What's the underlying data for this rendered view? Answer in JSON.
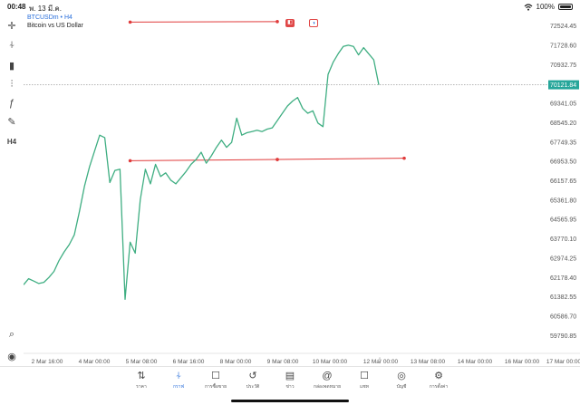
{
  "status_bar": {
    "time": "00:48",
    "date": "พ. 13 มี.ค.",
    "battery": "100%"
  },
  "chart": {
    "symbol": "BTCUSDm • H4",
    "description": "Bitcoin vs US Dollar",
    "current_price": "70121.84",
    "colors": {
      "line": "#3fae82",
      "trendline": "#e03b3b",
      "price_tag": "#26a69a",
      "accent": "#2a6fdb"
    }
  },
  "left_toolbar": [
    {
      "name": "crosshair-icon",
      "glyph": "✛"
    },
    {
      "name": "candles-icon",
      "glyph": "⍭"
    },
    {
      "name": "indicators-icon",
      "glyph": "▮"
    },
    {
      "name": "settings-sliders-icon",
      "glyph": "⫶"
    },
    {
      "name": "function-icon",
      "glyph": "ƒ"
    },
    {
      "name": "objects-icon",
      "glyph": "✎"
    },
    {
      "name": "timeframe-label",
      "glyph": "H4"
    },
    {
      "name": "search-chart-icon",
      "glyph": "⌕"
    },
    {
      "name": "app-logo-icon",
      "glyph": "◉"
    }
  ],
  "chart_data": {
    "type": "line",
    "x_ticks": [
      "2 Mar 16:00",
      "4 Mar 00:00",
      "5 Mar 08:00",
      "6 Mar 16:00",
      "8 Mar 00:00",
      "9 Mar 08:00",
      "10 Mar 00:00",
      "12 Mar 00:00",
      "13 Mar 08:00",
      "14 Mar 00:00",
      "16 Mar 00:00",
      "17 Mar 00:00"
    ],
    "y_ticks": [
      "72524.45",
      "71728.60",
      "70932.75",
      "70121.84",
      "69341.05",
      "68545.20",
      "67749.35",
      "66953.50",
      "66157.65",
      "65361.80",
      "64565.95",
      "63770.10",
      "62974.25",
      "62178.40",
      "61382.55",
      "60586.70",
      "59790.85"
    ],
    "ylim": [
      59600,
      72900
    ],
    "series": [
      {
        "values": [
          61900,
          62150,
          62050,
          61950,
          62000,
          62200,
          62450,
          62900,
          63250,
          63550,
          63950,
          64900,
          65950,
          66750,
          67400,
          68050,
          67950,
          66100,
          66600,
          66650,
          61300,
          63650,
          63200,
          65400,
          66650,
          66050,
          66850,
          66350,
          66500,
          66200,
          66050,
          66300,
          66550,
          66850,
          67050,
          67350,
          66900,
          67200,
          67550,
          67850,
          67550,
          67750,
          68750,
          68050,
          68150,
          68200,
          68250,
          68200,
          68300,
          68350,
          68650,
          68950,
          69250,
          69450,
          69600,
          69150,
          68950,
          69050,
          68550,
          68400,
          70550,
          71050,
          71400,
          71700,
          71750,
          71700,
          71350,
          71650,
          71400,
          71150,
          70121.84
        ]
      }
    ],
    "trendlines": [
      {
        "from": [
          21,
          67000
        ],
        "to": [
          50,
          67050
        ]
      },
      {
        "from": [
          50,
          67050
        ],
        "to": [
          75,
          67100
        ]
      },
      {
        "from": [
          21,
          72700
        ],
        "to": [
          50,
          72720
        ]
      }
    ],
    "grid": false
  },
  "bottom_nav": [
    {
      "name": "nav-quotes",
      "label": "ราคา",
      "glyph": "⇅",
      "active": false
    },
    {
      "name": "nav-chart",
      "label": "กราฟ",
      "glyph": "⍭",
      "active": true
    },
    {
      "name": "nav-trade",
      "label": "การซื้อขาย",
      "glyph": "☐",
      "active": false
    },
    {
      "name": "nav-history",
      "label": "ประวัติ",
      "glyph": "↺",
      "active": false
    },
    {
      "name": "nav-news",
      "label": "ข่าว",
      "glyph": "▤",
      "active": false
    },
    {
      "name": "nav-mailbox",
      "label": "กล่องจดหมาย",
      "glyph": "@",
      "active": false
    },
    {
      "name": "nav-chat",
      "label": "แชท",
      "glyph": "☐",
      "active": false
    },
    {
      "name": "nav-accounts",
      "label": "บัญชี",
      "glyph": "◎",
      "active": false
    },
    {
      "name": "nav-settings",
      "label": "การตั้งค่า",
      "glyph": "⚙",
      "active": false
    }
  ]
}
